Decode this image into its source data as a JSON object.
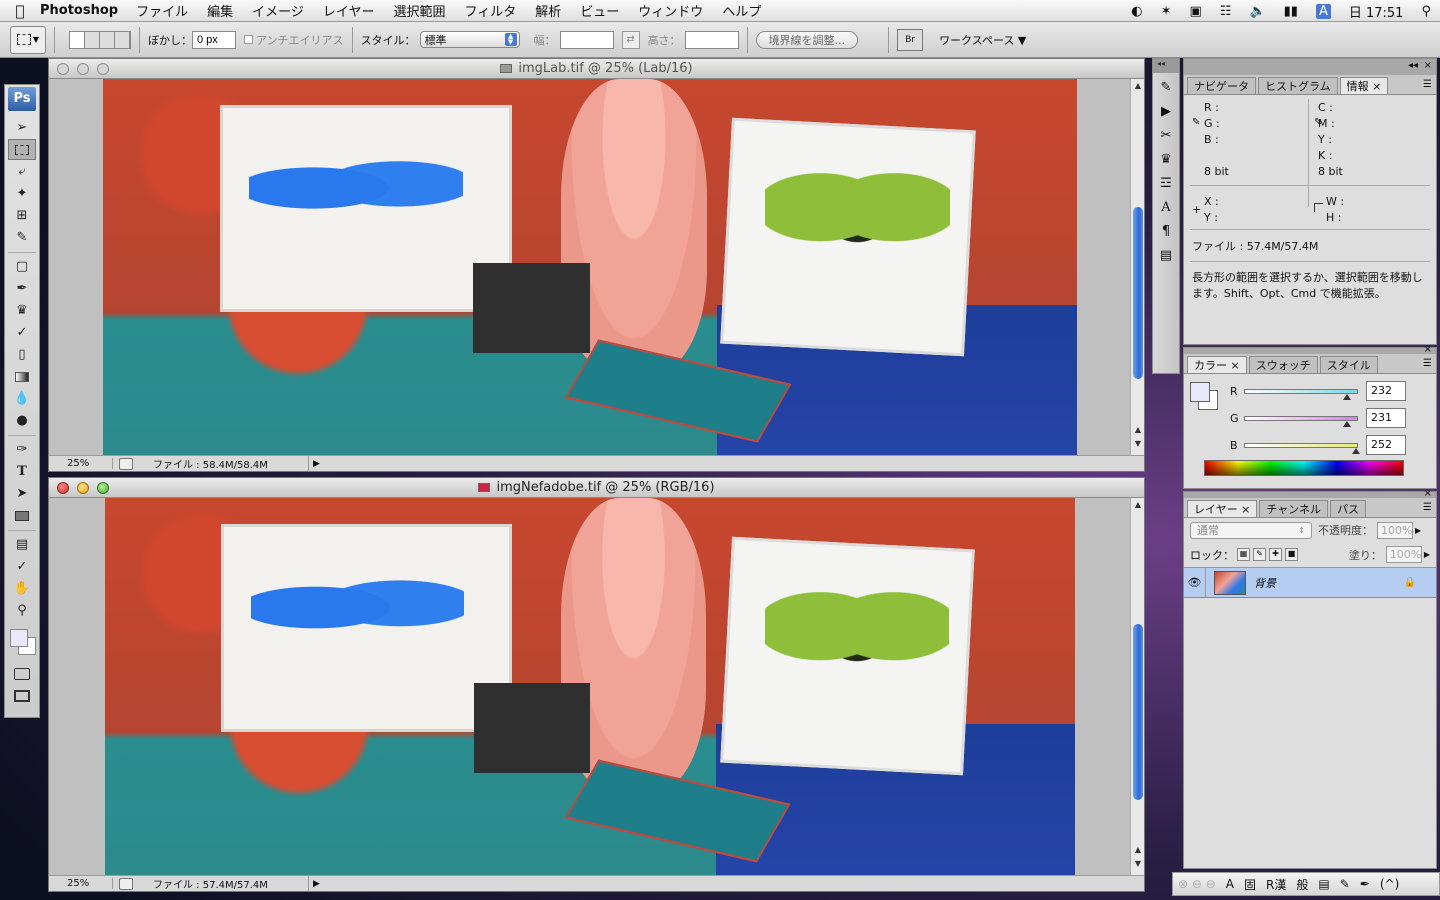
{
  "menubar": {
    "app": "Photoshop",
    "items": [
      "ファイル",
      "編集",
      "イメージ",
      "レイヤー",
      "選択範囲",
      "フィルタ",
      "解析",
      "ビュー",
      "ウィンドウ",
      "ヘルプ"
    ],
    "clock": "日 17:51",
    "input_mode": "A"
  },
  "options": {
    "feather_label": "ぼかし：",
    "feather_value": "0 px",
    "antialias_label": "アンチエイリアス",
    "style_label": "スタイル：",
    "style_value": "標準",
    "width_label": "幅：",
    "height_label": "高さ：",
    "refine_edge": "境界線を調整...",
    "workspace": "ワークスペース ▼"
  },
  "toolbox": {
    "logo": "Ps"
  },
  "documents": [
    {
      "title": "imgLab.tif @ 25% (Lab/16)",
      "zoom": "25%",
      "file_info": "ファイル : 58.4M/58.4M",
      "state": "inactive"
    },
    {
      "title": "imgNefadobe.tif @ 25% (RGB/16)",
      "zoom": "25%",
      "file_info": "ファイル : 57.4M/57.4M",
      "state": "active"
    }
  ],
  "info_panel": {
    "tabs": [
      "ナビゲータ",
      "ヒストグラム",
      "情報"
    ],
    "selected_tab": 2,
    "rgb_labels": [
      "R :",
      "G :",
      "B :"
    ],
    "cmyk_labels": [
      "C :",
      "M :",
      "Y :",
      "K :"
    ],
    "bit_left": "8 bit",
    "bit_right": "8 bit",
    "xy_labels": [
      "X :",
      "Y :"
    ],
    "wh_labels": [
      "W :",
      "H :"
    ],
    "file": "ファイル : 57.4M/57.4M",
    "hint": "長方形の範囲を選択するか、選択範囲を移動します。Shift、Opt、Cmd で機能拡張。"
  },
  "color_panel": {
    "tabs": [
      "カラー",
      "スウォッチ",
      "スタイル"
    ],
    "selected_tab": 0,
    "channels": [
      {
        "label": "R",
        "value": "232",
        "level": 0.91,
        "track_color": "#7fd3e6"
      },
      {
        "label": "G",
        "value": "231",
        "level": 0.91,
        "track_color": "#d67fe6"
      },
      {
        "label": "B",
        "value": "252",
        "level": 0.99,
        "track_color": "#e6e67f"
      }
    ],
    "foreground": "#e8e7fc",
    "background": "#ffffff"
  },
  "layers_panel": {
    "tabs": [
      "レイヤー",
      "チャンネル",
      "パス"
    ],
    "selected_tab": 0,
    "blend_mode": "通常",
    "opacity_label": "不透明度：",
    "opacity_value": "100%",
    "lock_label": "ロック：",
    "fill_label": "塗り：",
    "fill_value": "100%",
    "layer_name": "背景"
  },
  "bottom_bar": {
    "items": [
      "A",
      "固",
      "R漢",
      "般"
    ]
  }
}
